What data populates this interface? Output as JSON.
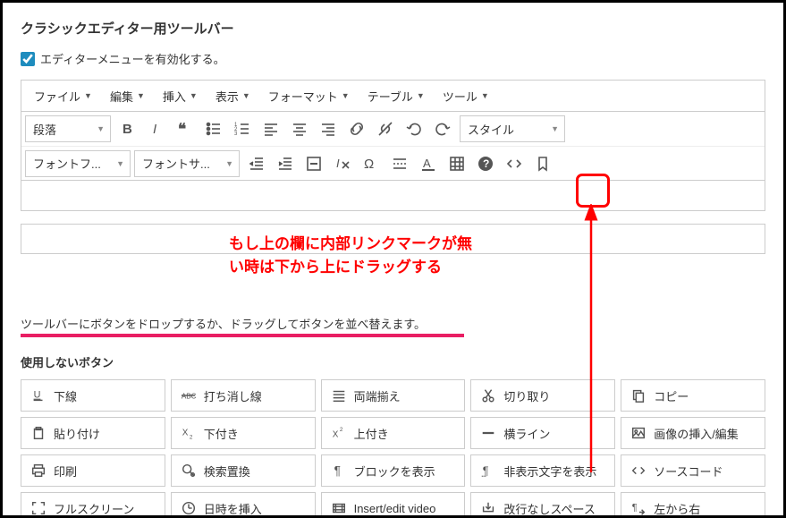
{
  "colors": {
    "highlight": "#e91e63",
    "annotation": "#ff0000"
  },
  "header": {
    "title": "クラシックエディター用ツールバー",
    "enable_menu_label": "エディターメニューを有効化する。"
  },
  "menubar": {
    "items": [
      "ファイル",
      "編集",
      "挿入",
      "表示",
      "フォーマット",
      "テーブル",
      "ツール"
    ]
  },
  "toolbar_row1": {
    "paragraph_select": "段落",
    "style_select": "スタイル",
    "icons": [
      "bold",
      "italic",
      "quote",
      "bullet-list",
      "number-list",
      "align-left",
      "align-center",
      "align-right",
      "link",
      "unlink",
      "undo",
      "redo"
    ]
  },
  "toolbar_row2": {
    "font_family_select": "フォントフ...",
    "font_size_select": "フォントサ...",
    "icons": [
      "outdent",
      "indent",
      "hr-insert",
      "clear-format",
      "omega",
      "page-break",
      "text-color",
      "table-icon",
      "help",
      "code",
      "bookmark"
    ]
  },
  "annotation": {
    "line1": "もし上の欄に内部リンクマークが無",
    "line2": "い時は下から上にドラッグする"
  },
  "drop_hint": "ツールバーにボタンをドロップするか、ドラッグしてボタンを並べ替えます。",
  "unused_title": "使用しないボタン",
  "unused_buttons": [
    {
      "icon": "underline",
      "label": "下線"
    },
    {
      "icon": "strike",
      "label": "打ち消し線"
    },
    {
      "icon": "justify",
      "label": "両端揃え"
    },
    {
      "icon": "cut",
      "label": "切り取り"
    },
    {
      "icon": "copy",
      "label": "コピー"
    },
    {
      "icon": "paste",
      "label": "貼り付け"
    },
    {
      "icon": "subscript",
      "label": "下付き"
    },
    {
      "icon": "superscript",
      "label": "上付き"
    },
    {
      "icon": "hr",
      "label": "横ライン"
    },
    {
      "icon": "image",
      "label": "画像の挿入/編集"
    },
    {
      "icon": "print",
      "label": "印刷"
    },
    {
      "icon": "search",
      "label": "検索置換"
    },
    {
      "icon": "pilcrow",
      "label": "ブロックを表示"
    },
    {
      "icon": "invisible",
      "label": "非表示文字を表示"
    },
    {
      "icon": "source",
      "label": "ソースコード"
    },
    {
      "icon": "fullscreen",
      "label": "フルスクリーン"
    },
    {
      "icon": "datetime",
      "label": "日時を挿入"
    },
    {
      "icon": "video",
      "label": "Insert/edit video"
    },
    {
      "icon": "nbsp",
      "label": "改行なしスペース"
    },
    {
      "icon": "ltr",
      "label": "左から右"
    }
  ]
}
